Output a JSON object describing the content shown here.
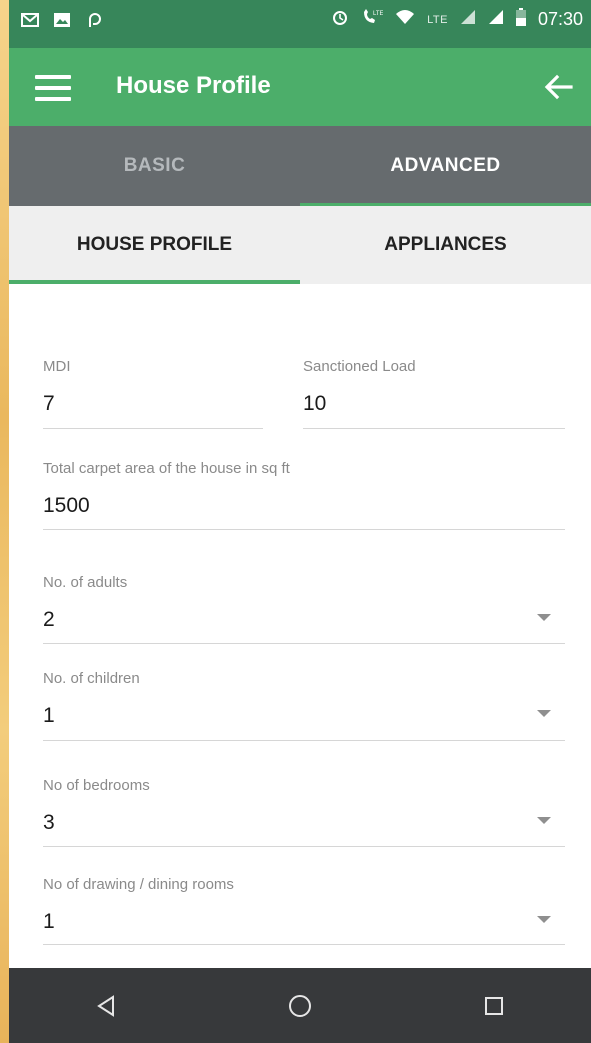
{
  "status_bar": {
    "lte_label": "LTE",
    "time": "07:30",
    "icons": [
      "gmail-icon",
      "gallery-icon",
      "app-icon",
      "alarm-icon",
      "volte-call-icon",
      "wifi-icon",
      "signal-icon",
      "signal-icon",
      "battery-icon"
    ]
  },
  "app_bar": {
    "title": "House Profile",
    "bg_color": "#4cae6a"
  },
  "main_tabs": [
    {
      "label": "BASIC",
      "active": false
    },
    {
      "label": "ADVANCED",
      "active": true
    }
  ],
  "sub_tabs": [
    {
      "label": "HOUSE PROFILE",
      "active": true
    },
    {
      "label": "APPLIANCES",
      "active": false
    }
  ],
  "form": {
    "mdi": {
      "label": "MDI",
      "value": "7"
    },
    "sanctioned_load": {
      "label": "Sanctioned Load",
      "value": "10"
    },
    "carpet_area": {
      "label": "Total carpet area of the house in sq ft",
      "value": "1500"
    },
    "adults": {
      "label": "No. of adults",
      "value": "2"
    },
    "children": {
      "label": "No. of children",
      "value": "1"
    },
    "bedrooms": {
      "label": "No of bedrooms",
      "value": "3"
    },
    "drawing_dining": {
      "label": "No of drawing / dining rooms",
      "value": "1"
    }
  },
  "nav_bar": {
    "buttons": [
      "back-triangle-icon",
      "home-circle-icon",
      "recents-square-icon"
    ]
  }
}
